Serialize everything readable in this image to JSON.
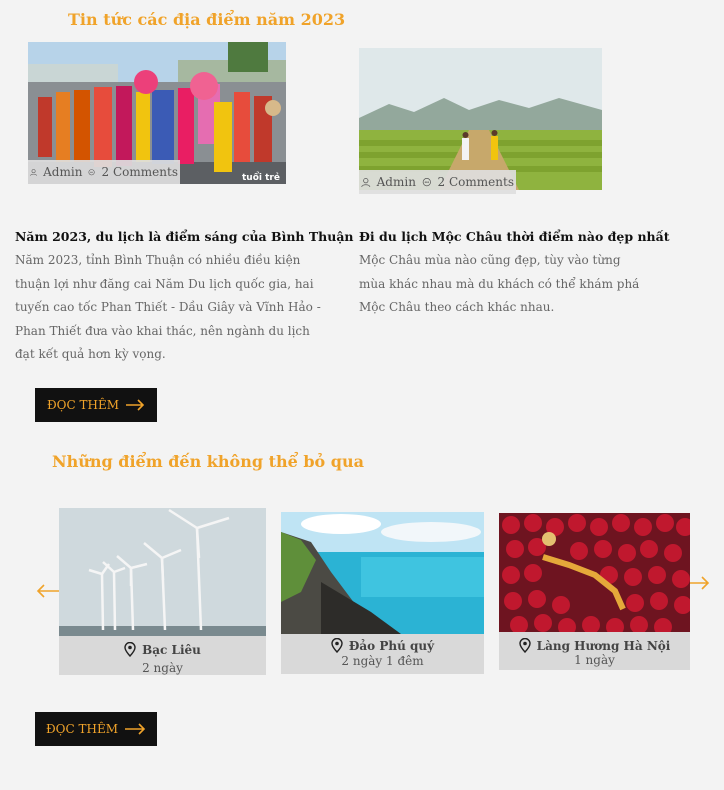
{
  "news_section": {
    "title": "Tin tức các địa điểm năm 2023",
    "articles": [
      {
        "author": "Admin",
        "comments": "2 Comments",
        "title": "Năm 2023, du lịch là điểm sáng của Bình Thuận",
        "description": "Năm 2023, tỉnh Bình Thuận có nhiều điều kiện thuận lợi như đăng cai Năm Du lịch quốc gia, hai tuyến cao tốc Phan Thiết - Dầu Giây và Vĩnh Hảo - Phan Thiết đưa vào khai thác, nên ngành du lịch đạt kết quả hơn kỳ vọng.",
        "image_watermark": "tuổi trẻ"
      },
      {
        "author": "Admin",
        "comments": "2 Comments",
        "title": "Đi du lịch Mộc Châu thời điểm nào đẹp nhất",
        "description": "Mộc Châu mùa nào cũng đẹp, tùy vào từng mùa khác nhau mà du khách có thể khám phá Mộc Châu theo cách khác nhau."
      }
    ],
    "read_more": "ĐỌC THÊM"
  },
  "destinations_section": {
    "title": "Những điểm đến không thể bỏ qua",
    "items": [
      {
        "name": "Bạc Liêu",
        "duration": "2 ngày"
      },
      {
        "name": "Đảo Phú quý",
        "duration": "2 ngày 1 đêm"
      },
      {
        "name": "Làng Hương Hà Nội",
        "duration": "1 ngày"
      }
    ],
    "read_more": "ĐỌC THÊM"
  },
  "colors": {
    "accent": "#f0a32a",
    "button_bg": "#111111",
    "card_info_bg": "#d9d9d9"
  },
  "icons": [
    "user-icon",
    "comment-icon",
    "arrow-right-icon",
    "arrow-left-icon",
    "map-pin-icon"
  ]
}
